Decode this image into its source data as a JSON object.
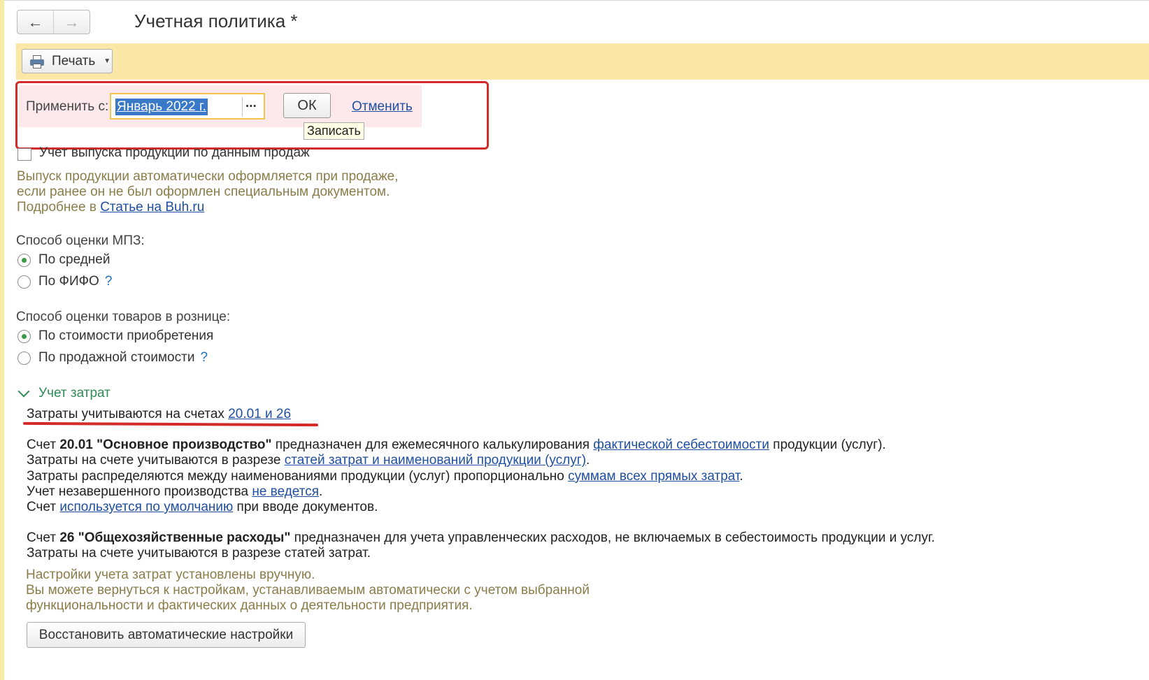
{
  "window": {
    "title": "Учетная политика *"
  },
  "nav": {
    "back_icon": "←",
    "forward_icon": "→"
  },
  "toolbar": {
    "print_label": "Печать"
  },
  "apply": {
    "label": "Применить с:",
    "date_value": "Январь 2022 г.",
    "select_label": "...",
    "ok_label": "ОК",
    "cancel_label": "Отменить",
    "tooltip": "Записать"
  },
  "production": {
    "checkbox_label": "Учет выпуска продукции по данным продаж",
    "checked": false,
    "hint_line1": "Выпуск продукции автоматически оформляется при продаже,",
    "hint_line2": "если ранее он не был оформлен специальным документом.",
    "hint_more_prefix": "Подробнее в ",
    "hint_more_link": "Статье на Buh.ru"
  },
  "mpz": {
    "title": "Способ оценки МПЗ:",
    "options": [
      {
        "label": "По средней",
        "checked": true
      },
      {
        "label": "По ФИФО",
        "checked": false,
        "help": "?"
      }
    ]
  },
  "retail": {
    "title": "Способ оценки товаров в рознице:",
    "options": [
      {
        "label": "По стоимости приобретения",
        "checked": true
      },
      {
        "label": "По продажной стоимости",
        "checked": false,
        "help": "?"
      }
    ]
  },
  "costs": {
    "group_title": "Учет затрат",
    "accounts_prefix": "Затраты учитываются на счетах ",
    "accounts_link": "20.01 и 26",
    "acc2001": {
      "l1_pre": "Счет ",
      "l1_bold": "20.01 \"Основное производство\"",
      "l1_mid": " предназначен для ежемесячного калькулирования ",
      "l1_link": "фактической себестоимости",
      "l1_post": " продукции (услуг).",
      "l2_pre": "Затраты на счете учитываются в разрезе ",
      "l2_link": "статей затрат и наименований продукции (услуг)",
      "l2_post": ".",
      "l3_pre": "Затраты распределяются между наименованиями продукции (услуг) пропорционально ",
      "l3_link": "суммам всех прямых затрат",
      "l3_post": ".",
      "l4_pre": "Учет незавершенного производства ",
      "l4_link": "не ведется",
      "l4_post": ".",
      "l5_pre": "Счет ",
      "l5_link": "используется по умолчанию",
      "l5_post": " при вводе документов."
    },
    "acc26": {
      "l1_pre": "Счет ",
      "l1_bold": "26 \"Общехозяйственные расходы\"",
      "l1_post": " предназначен для учета управленческих расходов, не включаемых в себестоимость продукции и услуг.",
      "l2": "Затраты на счете учитываются в разрезе статей затрат."
    },
    "manual_hint_l1": "Настройки учета затрат установлены вручную.",
    "manual_hint_l2": "Вы можете вернуться к настройкам, устанавливаемым автоматически с учетом выбранной",
    "manual_hint_l3": "функциональности и фактических данных о деятельности предприятия.",
    "restore_label": "Восстановить автоматические настройки"
  }
}
